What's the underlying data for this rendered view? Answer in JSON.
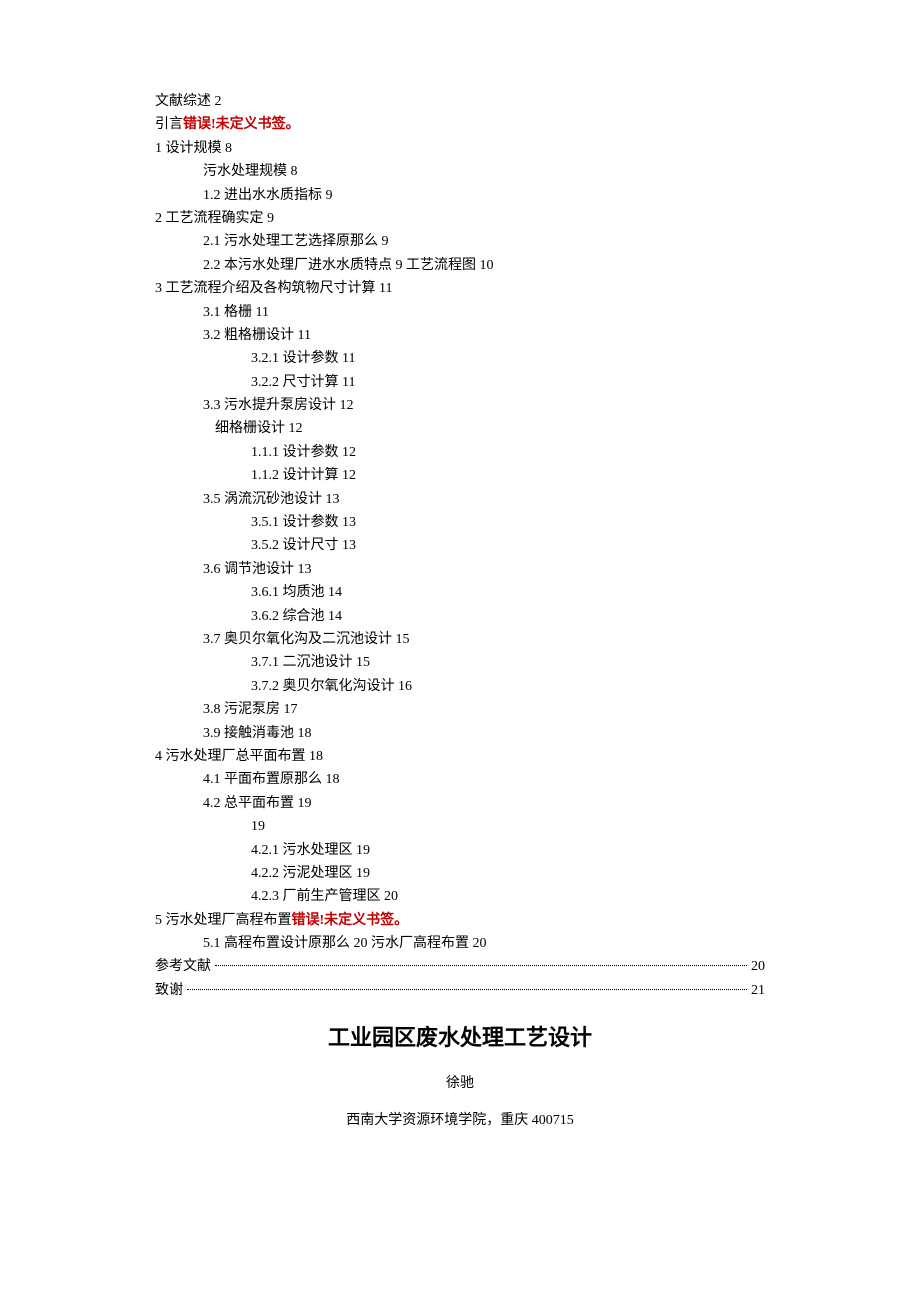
{
  "toc": {
    "lines": [
      {
        "level": 0,
        "text": "文献综述 2"
      },
      {
        "level": 0,
        "pre": "引言",
        "error": "错误!未定义书签。"
      },
      {
        "level": 0,
        "text": "1 设计规模 8"
      },
      {
        "level": 1,
        "text": "污水处理规模 8"
      },
      {
        "level": 2,
        "text": "1.2 进出水水质指标 9"
      },
      {
        "level": 0,
        "text": "2 工艺流程确实定 9"
      },
      {
        "level": 2,
        "text": "2.1   污水处理工艺选择原那么 9"
      },
      {
        "level": 2,
        "text": "2.2   本污水处理厂进水水质特点 9 工艺流程图 10"
      },
      {
        "level": 0,
        "text": "3 工艺流程介绍及各构筑物尺寸计算 11"
      },
      {
        "level": 2,
        "text": "3.1   格栅 11"
      },
      {
        "level": 2,
        "text": "3.2   粗格栅设计 11"
      },
      {
        "level": 3,
        "text": "3.2.1   设计参数 11"
      },
      {
        "level": 3,
        "text": "3.2.2   尺寸计算 11"
      },
      {
        "level": 2,
        "text": "3.3   污水提升泵房设计 12"
      },
      {
        "level": "sub",
        "text": "细格栅设计 12"
      },
      {
        "level": 3,
        "text": "1.1.1   设计参数 12"
      },
      {
        "level": 3,
        "text": "1.1.2   设计计算 12"
      },
      {
        "level": 2,
        "text": "3.5   涡流沉砂池设计 13"
      },
      {
        "level": 3,
        "text": "3.5.1   设计参数 13"
      },
      {
        "level": 3,
        "text": "3.5.2   设计尺寸 13"
      },
      {
        "level": 2,
        "text": "3.6   调节池设计 13"
      },
      {
        "level": 3,
        "text": "3.6.1   均质池 14"
      },
      {
        "level": 3,
        "text": "3.6.2   综合池 14"
      },
      {
        "level": 2,
        "text": "3.7   奥贝尔氧化沟及二沉池设计 15"
      },
      {
        "level": 3,
        "text": "3.7.1   二沉池设计 15"
      },
      {
        "level": 3,
        "text": "3.7.2   奥贝尔氧化沟设计 16"
      },
      {
        "level": 2,
        "text": "3.8   污泥泵房 17"
      },
      {
        "level": 2,
        "text": "3.9   接触消毒池 18"
      },
      {
        "level": 0,
        "text": "4 污水处理厂总平面布置 18"
      },
      {
        "level": 2,
        "text": "4.1   平面布置原那么 18"
      },
      {
        "level": 2,
        "text": "4.2   总平面布置 19"
      },
      {
        "level": "extra",
        "text": "19"
      },
      {
        "level": 3,
        "text": "4.2.1   污水处理区 19"
      },
      {
        "level": 3,
        "text": "4.2.2   污泥处理区 19"
      },
      {
        "level": 3,
        "text": "4.2.3   厂前生产管理区 20"
      },
      {
        "level": 0,
        "pre": "5 污水处理厂高程布置",
        "error": "错误!未定义书签。"
      },
      {
        "level": 2,
        "text": "5.1   高程布置设计原那么 20 污水厂高程布置 20"
      }
    ],
    "dotted": [
      {
        "label": "参考文献",
        "page": "20"
      },
      {
        "label": "致谢",
        "page": "21"
      }
    ]
  },
  "title": "工业园区废水处理工艺设计",
  "author": "徐驰",
  "affiliation": "西南大学资源环境学院，重庆 400715"
}
